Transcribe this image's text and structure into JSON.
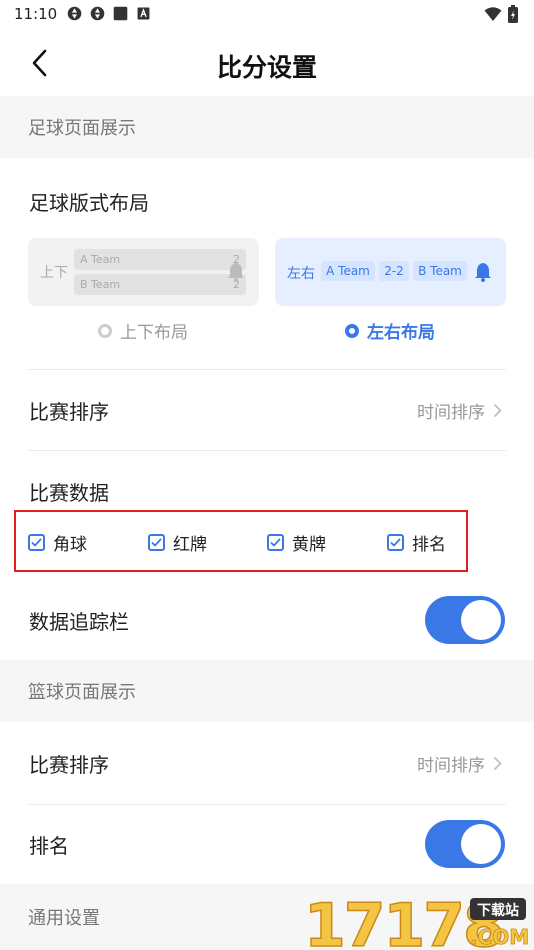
{
  "status_bar": {
    "time": "11:10"
  },
  "nav": {
    "title": "比分设置"
  },
  "football": {
    "section_title": "足球页面展示",
    "layout_title": "足球版式布局",
    "updown_preview": {
      "label": "上下",
      "team_a": "A Team",
      "score_a": "2",
      "team_b": "B Team",
      "score_b": "2"
    },
    "lr_preview": {
      "label": "左右",
      "team_a": "A Team",
      "score": "2-2",
      "team_b": "B Team"
    },
    "option_updown": "上下布局",
    "option_lr": "左右布局",
    "selected_layout": "左右布局",
    "sort_label": "比赛排序",
    "sort_value": "时间排序",
    "data_label": "比赛数据",
    "checkboxes": [
      {
        "label": "角球",
        "checked": true
      },
      {
        "label": "红牌",
        "checked": true
      },
      {
        "label": "黄牌",
        "checked": true
      },
      {
        "label": "排名",
        "checked": true
      }
    ],
    "tracker_label": "数据追踪栏",
    "tracker_on": true
  },
  "basketball": {
    "section_title": "篮球页面展示",
    "sort_label": "比赛排序",
    "sort_value": "时间排序",
    "rank_label": "排名",
    "rank_on": true
  },
  "general": {
    "section_title": "通用设置"
  },
  "watermark": {
    "number": "17178",
    "badge": "下载站",
    "domain": ".COM"
  },
  "colors": {
    "accent": "#3a78e8",
    "highlight": "#e02020"
  }
}
